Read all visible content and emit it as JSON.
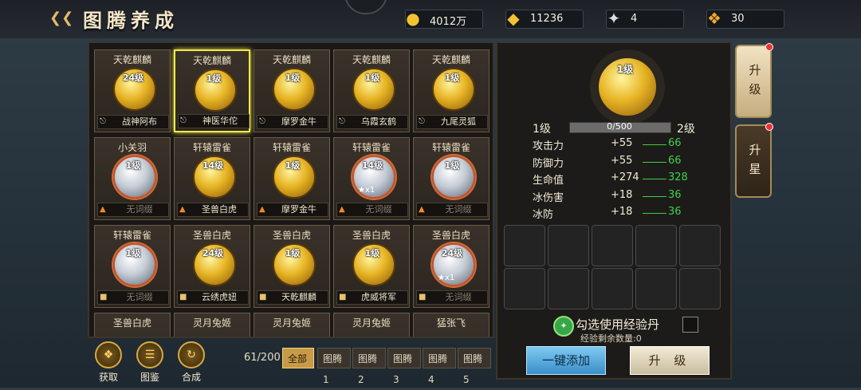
{
  "header": {
    "title": "图腾养成",
    "resources": [
      {
        "icon": "gold-coin-icon",
        "value": "4012万"
      },
      {
        "icon": "gold-ingot-icon",
        "value": "11236"
      },
      {
        "icon": "silver-token-icon",
        "value": "4"
      },
      {
        "icon": "gold-badge-icon",
        "value": "30"
      }
    ]
  },
  "cards": [
    {
      "name": "天乾麒麟",
      "level": "24级",
      "kind": "gold",
      "tag": "战神阿布",
      "tag_icon": "armor-icon",
      "selected": false,
      "stars": ""
    },
    {
      "name": "天乾麒麟",
      "level": "1级",
      "kind": "gold",
      "tag": "神医华佗",
      "tag_icon": "armor-icon",
      "selected": true,
      "stars": ""
    },
    {
      "name": "天乾麒麟",
      "level": "1级",
      "kind": "gold",
      "tag": "摩罗金牛",
      "tag_icon": "armor-icon",
      "selected": false,
      "stars": ""
    },
    {
      "name": "天乾麒麟",
      "level": "1级",
      "kind": "gold",
      "tag": "乌霞玄鹤",
      "tag_icon": "armor-icon",
      "selected": false,
      "stars": ""
    },
    {
      "name": "天乾麒麟",
      "level": "1级",
      "kind": "gold",
      "tag": "九尾灵狐",
      "tag_icon": "armor-icon",
      "selected": false,
      "stars": ""
    },
    {
      "name": "小关羽",
      "level": "1级",
      "kind": "silver",
      "tag": "无词缀",
      "tag_icon": "flame-icon",
      "selected": false,
      "stars": ""
    },
    {
      "name": "轩辕雷雀",
      "level": "14级",
      "kind": "gold",
      "tag": "圣兽白虎",
      "tag_icon": "flame-icon",
      "selected": false,
      "stars": ""
    },
    {
      "name": "轩辕雷雀",
      "level": "1级",
      "kind": "gold",
      "tag": "摩罗金牛",
      "tag_icon": "flame-icon",
      "selected": false,
      "stars": ""
    },
    {
      "name": "轩辕雷雀",
      "level": "14级",
      "kind": "silver",
      "tag": "无词缀",
      "tag_icon": "flame-icon",
      "selected": false,
      "stars": "★x1"
    },
    {
      "name": "轩辕雷雀",
      "level": "1级",
      "kind": "silver",
      "tag": "无词缀",
      "tag_icon": "flame-icon",
      "selected": false,
      "stars": ""
    },
    {
      "name": "轩辕雷雀",
      "level": "1级",
      "kind": "silver",
      "tag": "无词缀",
      "tag_icon": "scroll-icon",
      "selected": false,
      "stars": ""
    },
    {
      "name": "圣兽白虎",
      "level": "24级",
      "kind": "gold",
      "tag": "云绣虎妞",
      "tag_icon": "scroll-icon",
      "selected": false,
      "stars": ""
    },
    {
      "name": "圣兽白虎",
      "level": "1级",
      "kind": "gold",
      "tag": "天乾麒麟",
      "tag_icon": "scroll-icon",
      "selected": false,
      "stars": ""
    },
    {
      "name": "圣兽白虎",
      "level": "1级",
      "kind": "gold",
      "tag": "虎威将军",
      "tag_icon": "scroll-icon",
      "selected": false,
      "stars": ""
    },
    {
      "name": "圣兽白虎",
      "level": "24级",
      "kind": "silver",
      "tag": "无词缀",
      "tag_icon": "scroll-icon",
      "selected": false,
      "stars": "★x1"
    },
    {
      "name": "圣兽白虎",
      "level": "",
      "kind": "none",
      "tag": "",
      "tag_icon": "",
      "selected": false,
      "stars": ""
    },
    {
      "name": "灵月兔姬",
      "level": "",
      "kind": "none",
      "tag": "",
      "tag_icon": "",
      "selected": false,
      "stars": ""
    },
    {
      "name": "灵月兔姬",
      "level": "",
      "kind": "none",
      "tag": "",
      "tag_icon": "",
      "selected": false,
      "stars": ""
    },
    {
      "name": "灵月兔姬",
      "level": "",
      "kind": "none",
      "tag": "",
      "tag_icon": "",
      "selected": false,
      "stars": ""
    },
    {
      "name": "猛张飞",
      "level": "",
      "kind": "none",
      "tag": "",
      "tag_icon": "",
      "selected": false,
      "stars": ""
    }
  ],
  "bottom_actions": [
    {
      "label": "获取",
      "icon": "acquire-icon"
    },
    {
      "label": "图鉴",
      "icon": "codex-icon"
    },
    {
      "label": "合成",
      "icon": "synthesis-icon"
    }
  ],
  "count": "61/200",
  "filter_tabs": [
    "全部",
    "图腾1",
    "图腾2",
    "图腾3",
    "图腾4",
    "图腾5"
  ],
  "active_filter": 0,
  "detail": {
    "level": "1级",
    "level_from": "1级",
    "level_to": "2级",
    "xp_text": "0/500",
    "xp_fraction": 0,
    "stats": [
      {
        "name": "攻击力",
        "current": "+55",
        "next": "66"
      },
      {
        "name": "防御力",
        "current": "+55",
        "next": "66"
      },
      {
        "name": "生命值",
        "current": "+274",
        "next": "328"
      },
      {
        "name": "冰伤害",
        "current": "+18",
        "next": "36"
      },
      {
        "name": "冰防",
        "current": "+18",
        "next": "36"
      }
    ],
    "use_exp_label": "勾选使用经验丹",
    "exp_remaining": "经验剩余数量:0",
    "auto_add_label": "一键添加",
    "upgrade_label": "升 级"
  },
  "side_tabs": [
    {
      "label": "升级",
      "active": true
    },
    {
      "label": "升星",
      "active": false
    }
  ],
  "colors": {
    "accent_gold": "#e7b424",
    "selected_border": "#f2e94a",
    "stat_green": "#3fd24a"
  }
}
